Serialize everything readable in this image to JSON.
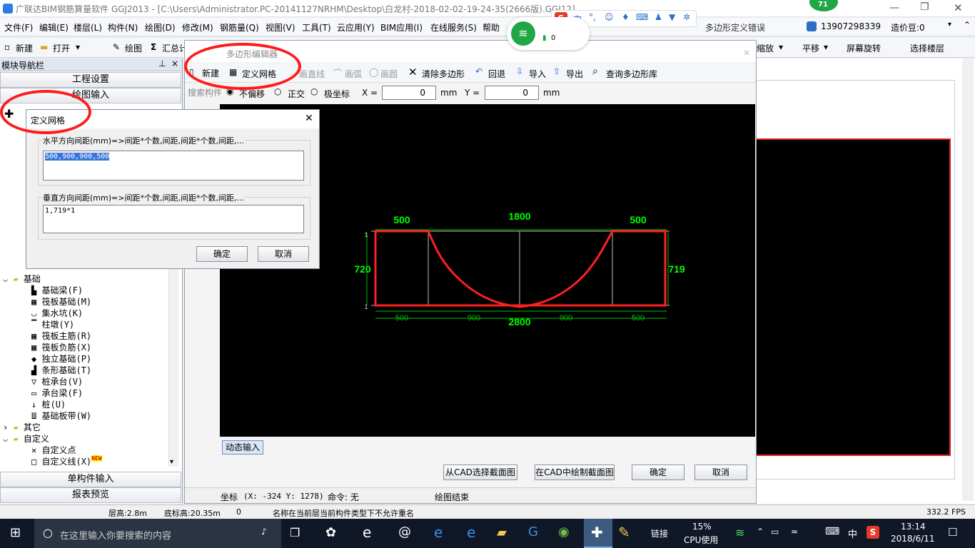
{
  "window": {
    "title": "广联达BIM钢筋算量软件 GGJ2013 - [C:\\Users\\Administrator.PC-20141127NRHM\\Desktop\\白龙村-2018-02-02-19-24-35(2666版).GGJ12]",
    "right_notice": "多边形定义错误",
    "account": "13907298339",
    "price": "造价豆:0"
  },
  "menu": [
    "文件(F)",
    "编辑(E)",
    "楼层(L)",
    "构件(N)",
    "绘图(D)",
    "修改(M)",
    "钢筋量(Q)",
    "视图(V)",
    "工具(T)",
    "云应用(Y)",
    "BIM应用(I)",
    "在线服务(S)",
    "帮助"
  ],
  "toolbar": {
    "new": "新建",
    "open": "打开",
    "draw": "绘图",
    "calc": "汇总计算",
    "zoom": "缩放",
    "pan": "平移",
    "rotate": "屏幕旋转",
    "select_floor": "选择楼层"
  },
  "badge": {
    "count": "71",
    "net_value": "0"
  },
  "left_panel": {
    "title": "模块导航栏",
    "btn_project": "工程设置",
    "btn_draw": "绘图输入",
    "search_placeholder": "搜索构件",
    "tree": [
      {
        "type": "folder",
        "label": "基础"
      },
      {
        "type": "item",
        "label": "基础梁(F)"
      },
      {
        "type": "item",
        "label": "筏板基础(M)"
      },
      {
        "type": "item",
        "label": "集水坑(K)"
      },
      {
        "type": "item",
        "label": "柱墩(Y)"
      },
      {
        "type": "item",
        "label": "筏板主筋(R)"
      },
      {
        "type": "item",
        "label": "筏板负筋(X)"
      },
      {
        "type": "item",
        "label": "独立基础(P)"
      },
      {
        "type": "item",
        "label": "条形基础(T)"
      },
      {
        "type": "item",
        "label": "桩承台(V)"
      },
      {
        "type": "item",
        "label": "承台梁(F)"
      },
      {
        "type": "item",
        "label": "桩(U)"
      },
      {
        "type": "item",
        "label": "基础板带(W)"
      },
      {
        "type": "folder",
        "label": "其它"
      },
      {
        "type": "folder",
        "label": "自定义"
      },
      {
        "type": "item",
        "label": "自定义点"
      },
      {
        "type": "item",
        "label": "自定义线(X)"
      }
    ],
    "new_tag": "NEW",
    "btn_single": "单构件输入",
    "btn_report": "报表预览"
  },
  "poly_editor": {
    "title": "多边形编辑器",
    "tools": [
      "新建",
      "定义网格",
      "画直线",
      "画弧",
      "画圆",
      "清除多边形",
      "回退",
      "导入",
      "导出",
      "查询多边形库"
    ],
    "mode_options": [
      "不偏移",
      "正交",
      "极坐标"
    ],
    "x_label": "X =",
    "x_value": "0",
    "y_label": "Y =",
    "y_value": "0",
    "unit": "mm",
    "dynamic_input": "动态输入",
    "btn_cad_select": "从CAD选择截面图",
    "btn_cad_draw": "在CAD中绘制截面图",
    "btn_ok": "确定",
    "btn_cancel": "取消",
    "coord_label": "坐标",
    "coord_value": "(X: -324 Y: 1278)",
    "command_label": "命令: 无",
    "draw_status": "绘图结束"
  },
  "drawing": {
    "top_dims": [
      "500",
      "1800",
      "500"
    ],
    "left_dim": "720",
    "right_dim": "719",
    "bottom_dims": [
      "500",
      "900",
      "900",
      "500"
    ],
    "bottom_total": "2800",
    "left_tick_top": "1",
    "left_tick_bottom": "1"
  },
  "grid_dialog": {
    "title": "定义网格",
    "h_label": "水平方向间距(mm)=>间距*个数,间距,间距*个数,间距,...",
    "h_value": "500,900,900,500",
    "v_label": "垂直方向间距(mm)=>间距*个数,间距,间距*个数,间距,...",
    "v_value": "1,719*1",
    "ok": "确定",
    "cancel": "取消"
  },
  "statusbar": {
    "floor_height": "层高:2.8m",
    "base_height": "底标高:20.35m",
    "zero": "0",
    "message": "名称在当前层当前构件类型下不允许重名",
    "fps": "332.2 FPS"
  },
  "taskbar": {
    "search_placeholder": "在这里输入你要搜索的内容",
    "link": "链接",
    "cpu_percent": "15%",
    "cpu_label": "CPU使用",
    "ime": "中",
    "time": "13:14",
    "date": "2018/6/11"
  },
  "colors": {
    "annotation_red": "#ff1a1a",
    "cad_green": "#00ff00",
    "cad_bg": "#000000"
  }
}
